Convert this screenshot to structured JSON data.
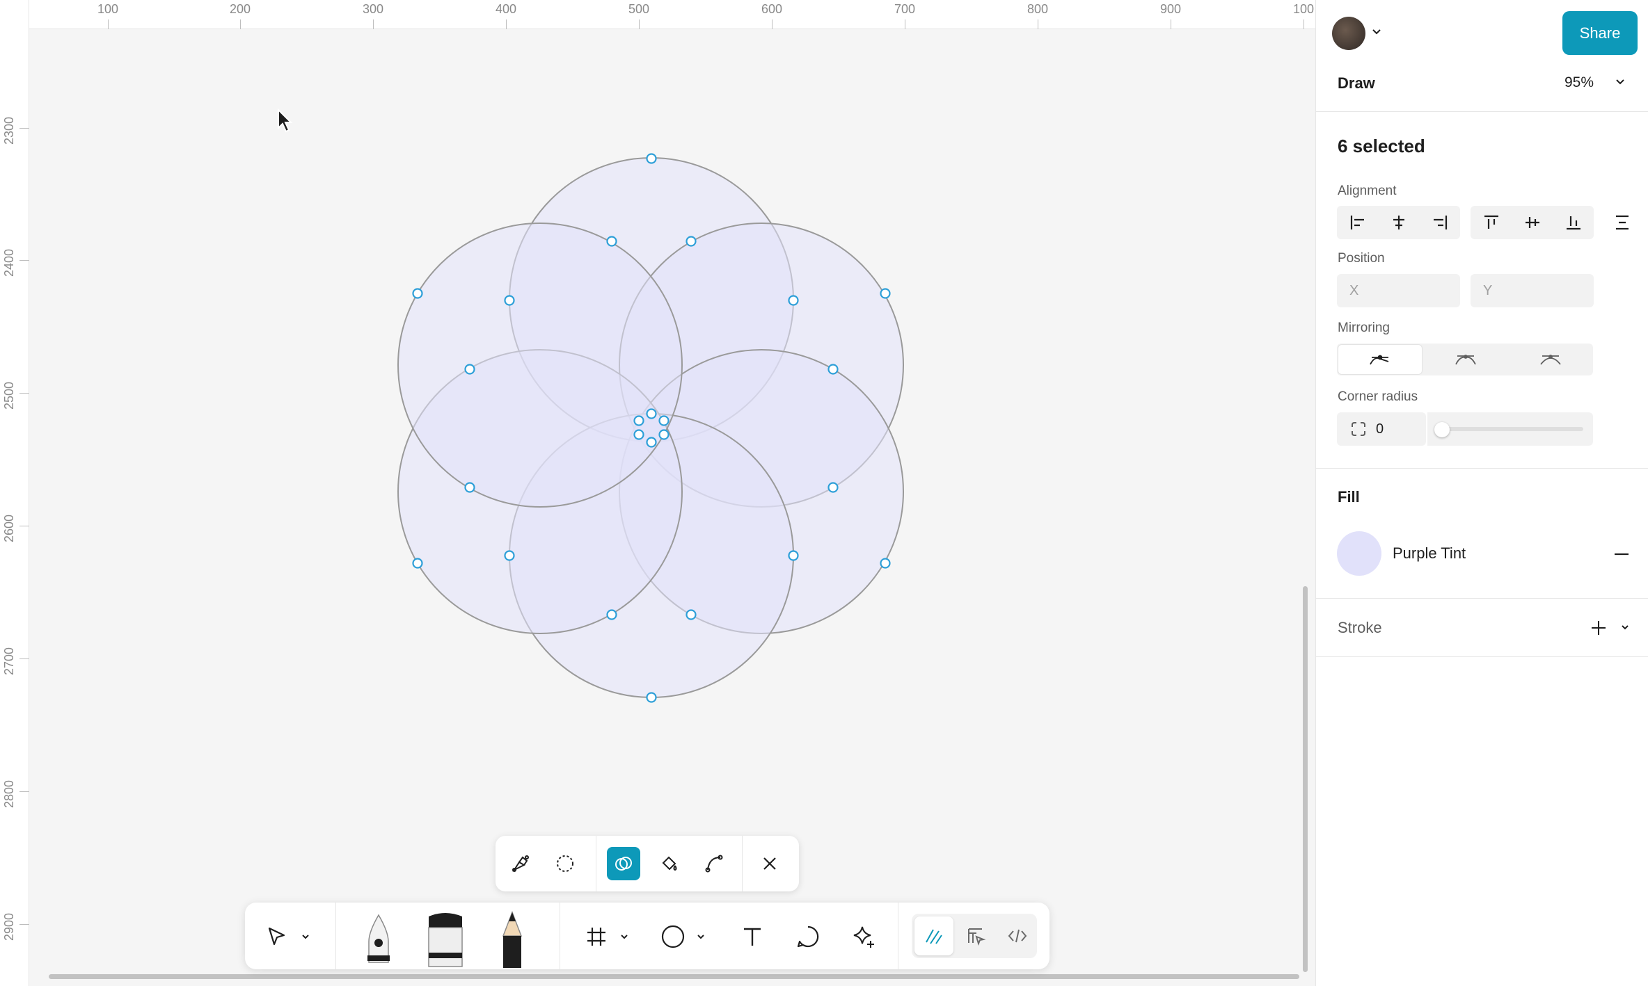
{
  "ruler": {
    "top_labels": [
      "100",
      "200",
      "300",
      "400",
      "500",
      "600",
      "700",
      "800",
      "900",
      "100"
    ],
    "left_labels": [
      "2300",
      "2400",
      "2500",
      "2600",
      "2700",
      "2800",
      "2900"
    ]
  },
  "header": {
    "share_label": "Share",
    "mode_label": "Draw",
    "zoom": "95%"
  },
  "selection": {
    "count_label": "6 selected"
  },
  "sections": {
    "alignment": "Alignment",
    "position": "Position",
    "mirroring": "Mirroring",
    "corner_radius": "Corner radius",
    "fill": "Fill",
    "stroke": "Stroke"
  },
  "position": {
    "x_placeholder": "X",
    "y_placeholder": "Y"
  },
  "corner_radius": {
    "value": "0",
    "slider_level": 0
  },
  "fill": {
    "name": "Purple Tint",
    "color": "#e1e1fa"
  },
  "colors": {
    "accent": "#0d99b9",
    "shape_fill": "#e1e1fa",
    "shape_stroke": "#9a9a9a",
    "handle": "#2d9fd8"
  },
  "toolbar": {
    "sub_tools": [
      "pen-vector-icon",
      "lasso-icon",
      "shape-builder-icon",
      "paint-bucket-icon",
      "bend-tool-icon",
      "close-icon"
    ],
    "main_tools": [
      "move-icon",
      "pen-icon",
      "marker-icon",
      "pencil-icon",
      "frame-icon",
      "ellipse-icon",
      "text-icon",
      "comment-icon",
      "ai-sparkle-icon",
      "draw-mode-icon",
      "design-mode-icon",
      "dev-mode-icon"
    ]
  }
}
